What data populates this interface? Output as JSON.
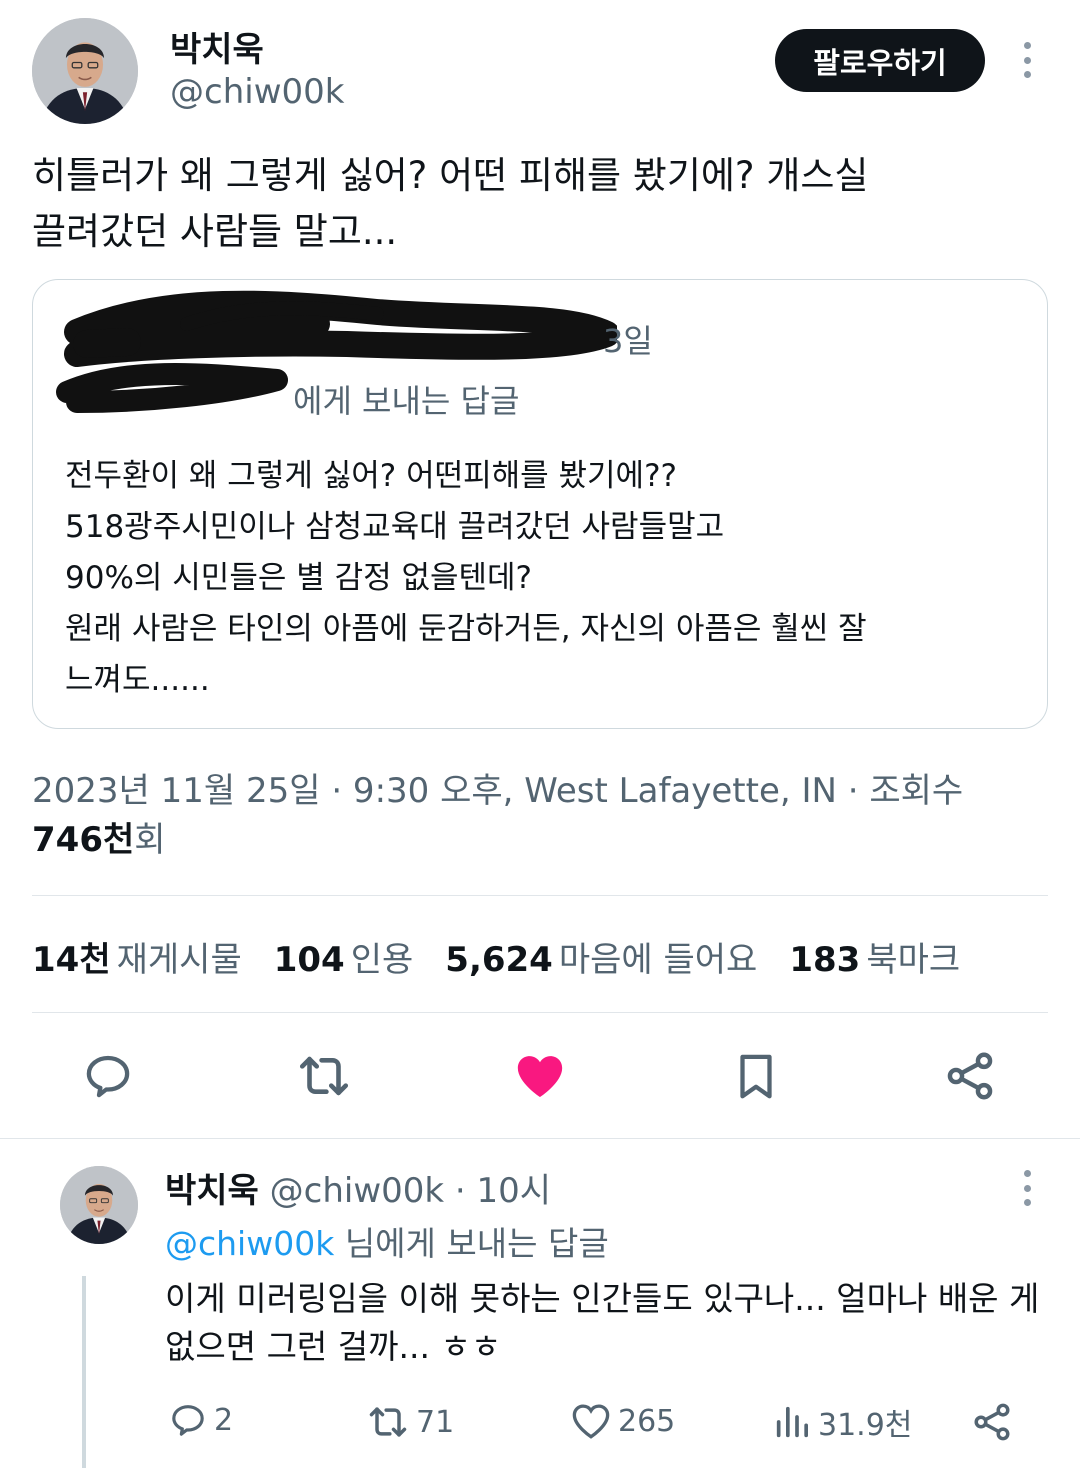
{
  "tweet": {
    "author_name": "박치욱",
    "author_handle": "@chiw00k",
    "follow_label": "팔로우하기",
    "text_lines": [
      "히틀러가 왜 그렇게 싫어? 어떤 피해를 봤기에? 개스실",
      "끌려갔던 사람들 말고..."
    ],
    "quote": {
      "time": "3일",
      "reply_to_suffix": "에게 보내는 답글",
      "body_lines": [
        "전두환이 왜 그렇게 싫어? 어떤피해를 봤기에??",
        "518광주시민이나 삼청교육대 끌려갔던 사람들말고",
        "90%의 시민들은 별 감정 없을텐데?",
        "원래 사람은 타인의 아픔에 둔감하거든, 자신의 아픔은 훨씬 잘",
        "느껴도......"
      ]
    },
    "meta": "2023년 11월 25일 · 9:30 오후, West Lafayette, IN · 조회수",
    "views_count": "746천",
    "views_suffix": "회",
    "stats": [
      {
        "count": "14천",
        "label": "재게시물"
      },
      {
        "count": "104",
        "label": "인용"
      },
      {
        "count": "5,624",
        "label": "마음에 들어요"
      },
      {
        "count": "183",
        "label": "북마크"
      }
    ],
    "actions": [
      {
        "icon": "reply-icon"
      },
      {
        "icon": "retweet-icon"
      },
      {
        "icon": "heart-filled-icon",
        "color": "#f91880"
      },
      {
        "icon": "bookmark-icon"
      },
      {
        "icon": "share-icon"
      }
    ]
  },
  "reply": {
    "author_name": "박치욱",
    "author_handle": "@chiw00k",
    "time": "· 10시",
    "reply_to_mention": "@chiw00k",
    "reply_to_suffix": " 님에게 보내는 답글",
    "text_lines": [
      "이게 미러링임을 이해 못하는 인간들도 있구나... 얼마나 배운 게",
      "없으면 그런 걸까... ㅎㅎ"
    ],
    "replies": "2",
    "retweets": "71",
    "likes": "265",
    "views": "31.9천"
  },
  "colors": {
    "text": "#0f1419",
    "muted": "#536471",
    "link": "#1d9bf0",
    "like": "#f91880",
    "border": "#cfd9de"
  }
}
